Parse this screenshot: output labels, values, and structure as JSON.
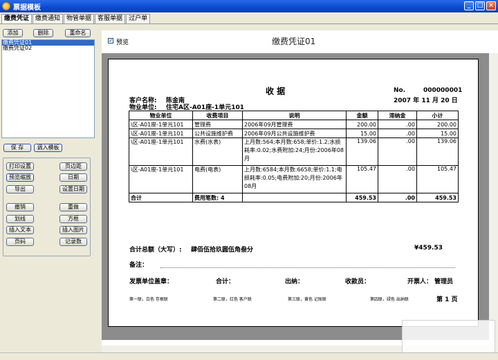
{
  "window": {
    "title": "票据模板"
  },
  "tabs": [
    "缴费凭证",
    "缴费通知",
    "物管单据",
    "客服单据",
    "过户单"
  ],
  "left_panel": {
    "buttons_top": [
      "添加",
      "删除",
      "重命名"
    ],
    "templates": [
      "缴费凭证01",
      "缴费凭证02"
    ],
    "save": "保 存",
    "load_template": "调入模板",
    "tools": [
      [
        "打印设置",
        "页边距"
      ],
      [
        "预览缩放",
        "日期"
      ],
      [
        "导出",
        "设置日期"
      ],
      [
        "撤销",
        "重做"
      ],
      [
        "划线",
        "方框"
      ],
      [
        "插入文本",
        "插入图片"
      ],
      [
        "页码",
        "记录数"
      ]
    ]
  },
  "preview": {
    "checkbox_label": "预览",
    "doc_title": "缴费凭证01"
  },
  "receipt": {
    "title": "收   据",
    "no_label": "No.",
    "no_value": "000000001",
    "date": "2007 年  11 月 20 日",
    "customer_label": "客户名称:",
    "customer_value": "陈金南",
    "unit_label": "物业单位:",
    "unit_value": "住宅A区-A01座-1单元101",
    "columns": [
      "物业单位",
      "收费项目",
      "说明",
      "金额",
      "滞纳金",
      "小计"
    ],
    "rows": [
      [
        "\\区-A01座-1单元101",
        "管理费",
        "2006年09月管理费",
        "200.00",
        ".00",
        "200.00"
      ],
      [
        "\\区-A01座-1单元101",
        "公共设施维护费",
        "2006年09月公共设施维护费",
        "15.00",
        ".00",
        "15.00"
      ],
      [
        "\\区-A01座-1单元101",
        "水费(水表)",
        "上月数:564;本月数:658;单价:1.2;水损耗率:0.02;水费附加:24;月份:2006年08月",
        "139.06",
        ".00",
        "139.06"
      ],
      [
        "\\区-A01座-1单元101",
        "电费(电表)",
        "上月数:6584;本月数:6658;单价:1.1;电损耗率:0.05;电费附加:20;月份:2006年08月",
        "105.47",
        ".00",
        "105.47"
      ]
    ],
    "total_label": "合计",
    "count_label": "费用笔数: 4",
    "total_amount": "459.53",
    "total_late": ".00",
    "total_sub": "459.53",
    "uppercase_label": "合计总额（大写）:",
    "uppercase_value": "肆佰伍拾玖圆伍角叁分",
    "yen_total": "¥459.53",
    "remark_label": "备注：",
    "sign_labels": [
      "发票单位盖章：",
      "合计：",
      "出纳：",
      "收款员：",
      "开票人：",
      "管理员"
    ],
    "copies": [
      "第一联，白色  存根联",
      "第二联，红色  客户联",
      "第三联，黄色  记账联",
      "第四联，绿色  出纳联"
    ],
    "page": "第 1 页"
  }
}
